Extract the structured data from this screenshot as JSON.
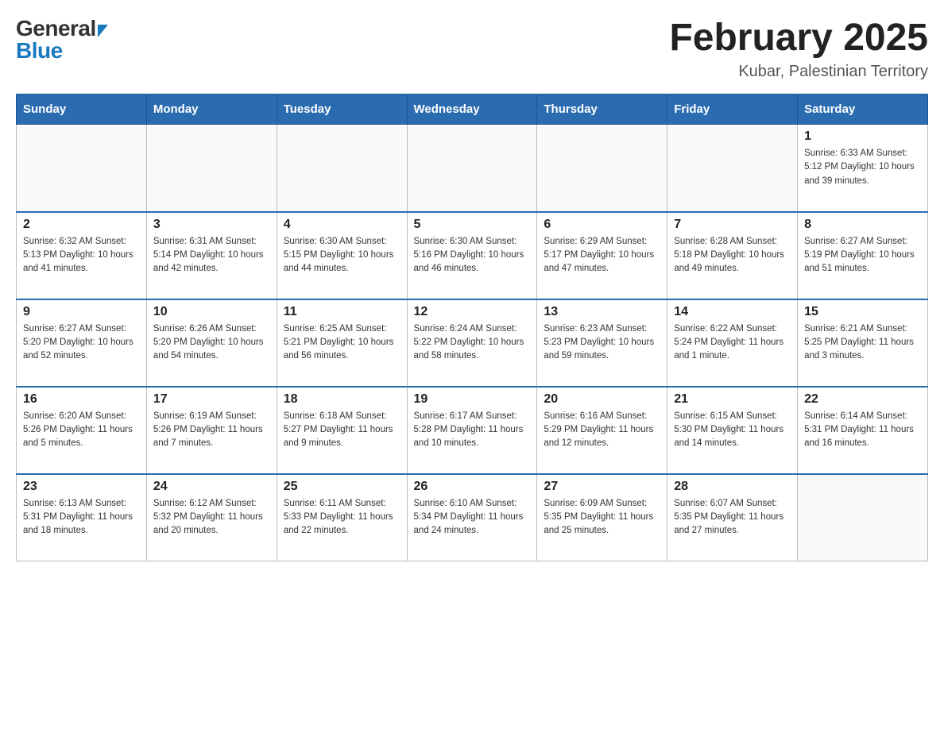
{
  "header": {
    "logo_general": "General",
    "logo_blue": "Blue",
    "title": "February 2025",
    "subtitle": "Kubar, Palestinian Territory"
  },
  "weekdays": [
    "Sunday",
    "Monday",
    "Tuesday",
    "Wednesday",
    "Thursday",
    "Friday",
    "Saturday"
  ],
  "weeks": [
    [
      {
        "day": "",
        "info": ""
      },
      {
        "day": "",
        "info": ""
      },
      {
        "day": "",
        "info": ""
      },
      {
        "day": "",
        "info": ""
      },
      {
        "day": "",
        "info": ""
      },
      {
        "day": "",
        "info": ""
      },
      {
        "day": "1",
        "info": "Sunrise: 6:33 AM\nSunset: 5:12 PM\nDaylight: 10 hours\nand 39 minutes."
      }
    ],
    [
      {
        "day": "2",
        "info": "Sunrise: 6:32 AM\nSunset: 5:13 PM\nDaylight: 10 hours\nand 41 minutes."
      },
      {
        "day": "3",
        "info": "Sunrise: 6:31 AM\nSunset: 5:14 PM\nDaylight: 10 hours\nand 42 minutes."
      },
      {
        "day": "4",
        "info": "Sunrise: 6:30 AM\nSunset: 5:15 PM\nDaylight: 10 hours\nand 44 minutes."
      },
      {
        "day": "5",
        "info": "Sunrise: 6:30 AM\nSunset: 5:16 PM\nDaylight: 10 hours\nand 46 minutes."
      },
      {
        "day": "6",
        "info": "Sunrise: 6:29 AM\nSunset: 5:17 PM\nDaylight: 10 hours\nand 47 minutes."
      },
      {
        "day": "7",
        "info": "Sunrise: 6:28 AM\nSunset: 5:18 PM\nDaylight: 10 hours\nand 49 minutes."
      },
      {
        "day": "8",
        "info": "Sunrise: 6:27 AM\nSunset: 5:19 PM\nDaylight: 10 hours\nand 51 minutes."
      }
    ],
    [
      {
        "day": "9",
        "info": "Sunrise: 6:27 AM\nSunset: 5:20 PM\nDaylight: 10 hours\nand 52 minutes."
      },
      {
        "day": "10",
        "info": "Sunrise: 6:26 AM\nSunset: 5:20 PM\nDaylight: 10 hours\nand 54 minutes."
      },
      {
        "day": "11",
        "info": "Sunrise: 6:25 AM\nSunset: 5:21 PM\nDaylight: 10 hours\nand 56 minutes."
      },
      {
        "day": "12",
        "info": "Sunrise: 6:24 AM\nSunset: 5:22 PM\nDaylight: 10 hours\nand 58 minutes."
      },
      {
        "day": "13",
        "info": "Sunrise: 6:23 AM\nSunset: 5:23 PM\nDaylight: 10 hours\nand 59 minutes."
      },
      {
        "day": "14",
        "info": "Sunrise: 6:22 AM\nSunset: 5:24 PM\nDaylight: 11 hours\nand 1 minute."
      },
      {
        "day": "15",
        "info": "Sunrise: 6:21 AM\nSunset: 5:25 PM\nDaylight: 11 hours\nand 3 minutes."
      }
    ],
    [
      {
        "day": "16",
        "info": "Sunrise: 6:20 AM\nSunset: 5:26 PM\nDaylight: 11 hours\nand 5 minutes."
      },
      {
        "day": "17",
        "info": "Sunrise: 6:19 AM\nSunset: 5:26 PM\nDaylight: 11 hours\nand 7 minutes."
      },
      {
        "day": "18",
        "info": "Sunrise: 6:18 AM\nSunset: 5:27 PM\nDaylight: 11 hours\nand 9 minutes."
      },
      {
        "day": "19",
        "info": "Sunrise: 6:17 AM\nSunset: 5:28 PM\nDaylight: 11 hours\nand 10 minutes."
      },
      {
        "day": "20",
        "info": "Sunrise: 6:16 AM\nSunset: 5:29 PM\nDaylight: 11 hours\nand 12 minutes."
      },
      {
        "day": "21",
        "info": "Sunrise: 6:15 AM\nSunset: 5:30 PM\nDaylight: 11 hours\nand 14 minutes."
      },
      {
        "day": "22",
        "info": "Sunrise: 6:14 AM\nSunset: 5:31 PM\nDaylight: 11 hours\nand 16 minutes."
      }
    ],
    [
      {
        "day": "23",
        "info": "Sunrise: 6:13 AM\nSunset: 5:31 PM\nDaylight: 11 hours\nand 18 minutes."
      },
      {
        "day": "24",
        "info": "Sunrise: 6:12 AM\nSunset: 5:32 PM\nDaylight: 11 hours\nand 20 minutes."
      },
      {
        "day": "25",
        "info": "Sunrise: 6:11 AM\nSunset: 5:33 PM\nDaylight: 11 hours\nand 22 minutes."
      },
      {
        "day": "26",
        "info": "Sunrise: 6:10 AM\nSunset: 5:34 PM\nDaylight: 11 hours\nand 24 minutes."
      },
      {
        "day": "27",
        "info": "Sunrise: 6:09 AM\nSunset: 5:35 PM\nDaylight: 11 hours\nand 25 minutes."
      },
      {
        "day": "28",
        "info": "Sunrise: 6:07 AM\nSunset: 5:35 PM\nDaylight: 11 hours\nand 27 minutes."
      },
      {
        "day": "",
        "info": ""
      }
    ]
  ]
}
